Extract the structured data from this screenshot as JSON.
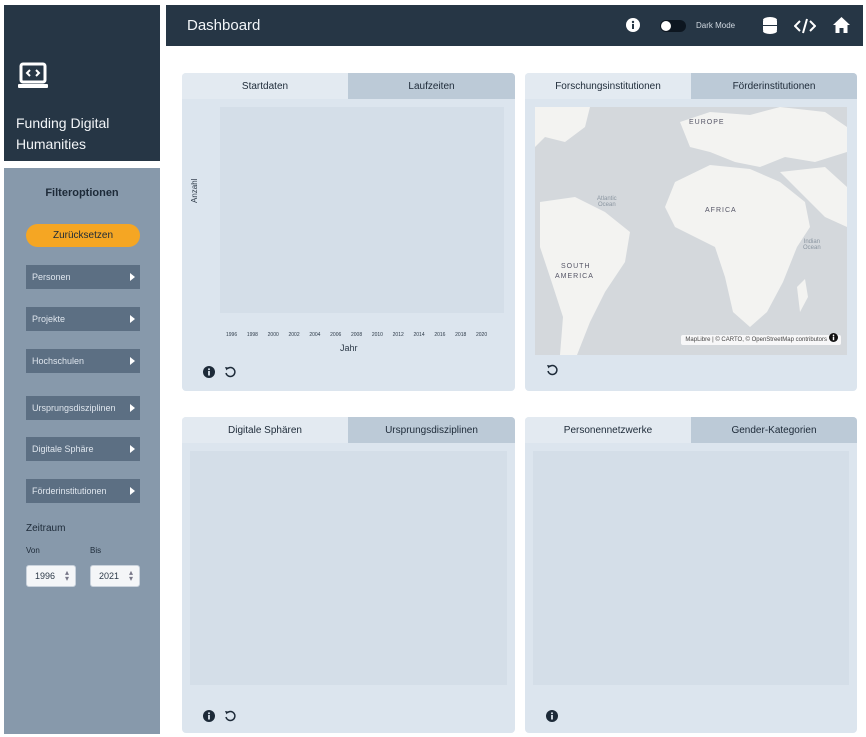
{
  "app": {
    "title_line1": "Funding Digital",
    "title_line2": "Humanities"
  },
  "topbar": {
    "title": "Dashboard",
    "dark_mode_label": "Dark Mode"
  },
  "filters": {
    "title": "Filteroptionen",
    "reset_label": "Zurücksetzen",
    "items": [
      "Personen",
      "Projekte",
      "Hochschulen",
      "Ursprungsdisziplinen",
      "Digitale Sphäre",
      "Förderinstitutionen"
    ],
    "zeitraum_label": "Zeitraum",
    "von_label": "Von",
    "bis_label": "Bis",
    "von_value": "1996",
    "bis_value": "2021"
  },
  "panel_timeline": {
    "tabs": [
      "Startdaten",
      "Laufzeiten"
    ],
    "active_tab": "Startdaten"
  },
  "chart_data": {
    "type": "bar",
    "categories": [
      "1996",
      "1998",
      "2000",
      "2002",
      "2004",
      "2006",
      "2008",
      "2010",
      "2012",
      "2014",
      "2016",
      "2018",
      "2020"
    ],
    "values": [],
    "xlabel": "Jahr",
    "ylabel": "Anzahl"
  },
  "panel_map": {
    "tabs": [
      "Forschungsinstitutionen",
      "Förderinstitutionen"
    ],
    "active_tab": "Forschungsinstitutionen",
    "labels": {
      "europe": "EUROPE",
      "africa": "AFRICA",
      "south_america_1": "SOUTH",
      "south_america_2": "AMERICA",
      "atlantic_1": "Atlantic",
      "atlantic_2": "Ocean",
      "indian_1": "Indian",
      "indian_2": "Ocean"
    },
    "attribution": "MapLibre | © CARTO, © OpenStreetMap contributors"
  },
  "panel_spheres": {
    "tabs": [
      "Digitale Sphären",
      "Ursprungsdisziplinen"
    ],
    "active_tab": "Digitale Sphären"
  },
  "panel_networks": {
    "tabs": [
      "Personennetzwerke",
      "Gender-Kategorien"
    ],
    "active_tab": "Personennetzwerke"
  },
  "colors": {
    "dark": "#263645",
    "sidebar": "#8799ab",
    "accent": "#f5a623",
    "panel": "#dce5ee"
  }
}
